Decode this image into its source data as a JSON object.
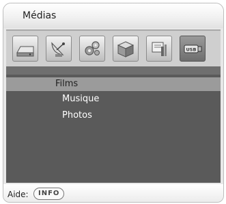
{
  "window": {
    "title": "Médias"
  },
  "icons": [
    {
      "name": "drive-icon"
    },
    {
      "name": "satellite-icon"
    },
    {
      "name": "settings-gears-icon"
    },
    {
      "name": "package-icon"
    },
    {
      "name": "tools-icon"
    },
    {
      "name": "usb-icon",
      "label": "USB",
      "selected": true
    }
  ],
  "menu": {
    "items": [
      {
        "label": "Films",
        "selected": true
      },
      {
        "label": "Musique",
        "selected": false
      },
      {
        "label": "Photos",
        "selected": false
      }
    ]
  },
  "footer": {
    "help_label": "Aide:",
    "info_button": "INFO"
  }
}
